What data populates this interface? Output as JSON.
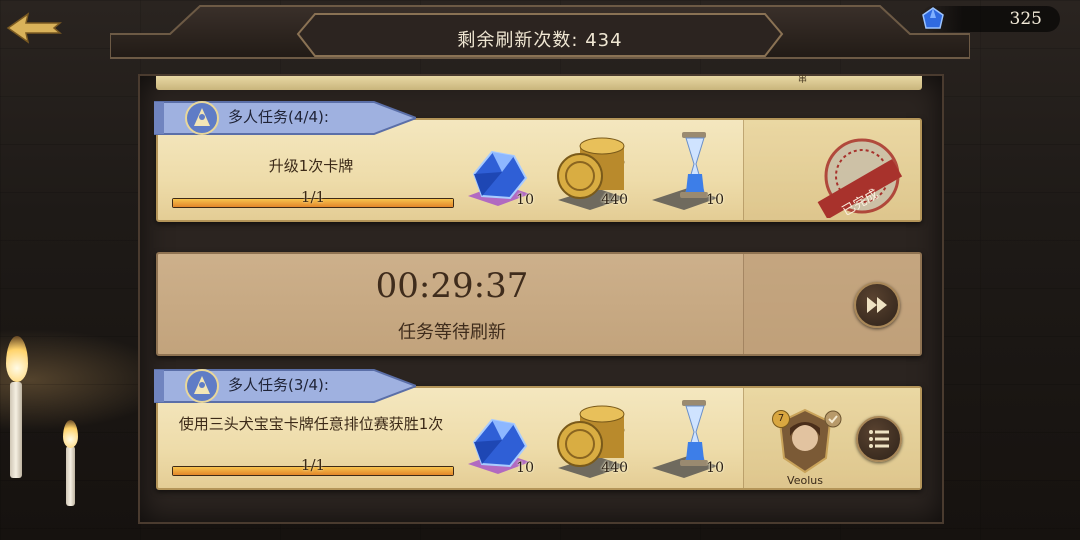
{
  "header": {
    "refresh_label": "剩余刷新次数: 434"
  },
  "currency": {
    "icon": "blue-gem-icon",
    "value": "325"
  },
  "peek_card": {
    "fragment_text": "串"
  },
  "tasks": [
    {
      "ribbon_label": "多人任务(4/4):",
      "description": "升级1次卡牌",
      "progress_text": "1/1",
      "progress": 1.0,
      "rewards": [
        {
          "icon": "blue-gem-icon",
          "qty": "10"
        },
        {
          "icon": "gold-coin-stack-icon",
          "qty": "440"
        },
        {
          "icon": "hourglass-icon",
          "qty": "10"
        }
      ],
      "status_stamp": "已完成"
    },
    {
      "ribbon_label": "多人任务(3/4):",
      "description": "使用三头犬宝宝卡牌任意排位赛获胜1次",
      "progress_text": "1/1",
      "progress": 1.0,
      "rewards": [
        {
          "icon": "blue-gem-icon",
          "qty": "10"
        },
        {
          "icon": "gold-coin-stack-icon",
          "qty": "440"
        },
        {
          "icon": "hourglass-icon",
          "qty": "10"
        }
      ],
      "helper": {
        "level": "7",
        "name": "Veolus"
      }
    }
  ],
  "waiting_card": {
    "timer": "00:29:37",
    "subtitle": "任务等待刷新"
  },
  "colors": {
    "card_bg": "#f4e7bf",
    "ribbon_blue": "#8fa3d8",
    "progress_fill": "#f7c34d",
    "stamp_red": "#a8322c"
  }
}
